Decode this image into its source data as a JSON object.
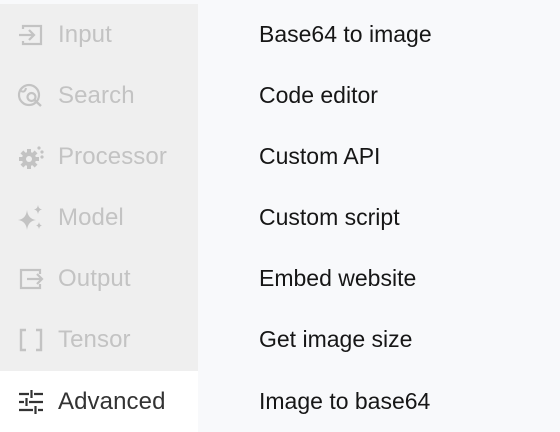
{
  "sidebar": {
    "items": [
      {
        "label": "Input",
        "icon": "input-icon",
        "selected": false
      },
      {
        "label": "Search",
        "icon": "search-icon",
        "selected": false
      },
      {
        "label": "Processor",
        "icon": "processor-gear-icon",
        "selected": false
      },
      {
        "label": "Model",
        "icon": "sparkle-icon",
        "selected": false
      },
      {
        "label": "Output",
        "icon": "output-icon",
        "selected": false
      },
      {
        "label": "Tensor",
        "icon": "brackets-icon",
        "selected": false
      },
      {
        "label": "Advanced",
        "icon": "sliders-icon",
        "selected": true
      }
    ]
  },
  "list": {
    "items": [
      {
        "label": "Base64 to image"
      },
      {
        "label": "Code editor"
      },
      {
        "label": "Custom API"
      },
      {
        "label": "Custom script"
      },
      {
        "label": "Embed website"
      },
      {
        "label": "Get image size"
      },
      {
        "label": "Image to base64"
      }
    ]
  },
  "colors": {
    "disabled_text": "#c3c3c3",
    "selected_text": "#333333",
    "sidebar_bg": "#efefef",
    "selected_bg": "#ffffff",
    "page_bg": "#f8f9fb",
    "list_text": "#161616"
  }
}
